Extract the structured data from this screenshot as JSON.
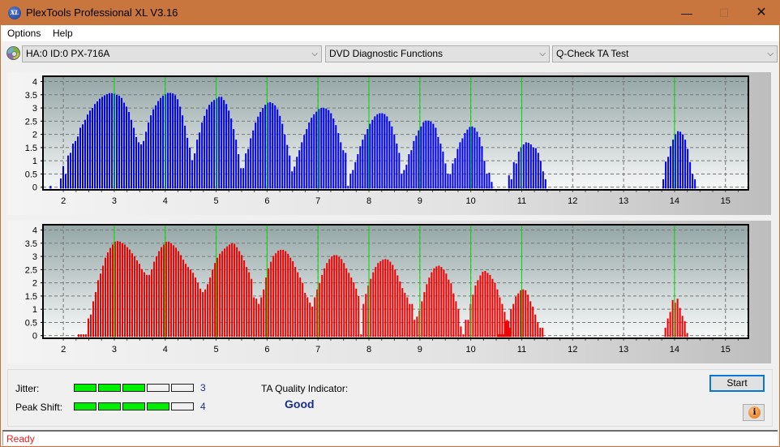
{
  "window": {
    "title": "PlexTools Professional XL V3.16",
    "icon_label": "XL",
    "controls": {
      "minimize": "—",
      "maximize": "☐",
      "close": "✕"
    }
  },
  "menu": {
    "items": [
      {
        "label": "Options"
      },
      {
        "label": "Help"
      }
    ]
  },
  "toolbar": {
    "drive_select": "HA:0 ID:0  PX-716A",
    "function_select": "DVD Diagnostic Functions",
    "test_select": "Q-Check TA Test",
    "chevron": "⌵"
  },
  "colors": {
    "title_bar": "#c8763e",
    "jitter_bars": "#0000ee",
    "peak_shift_bars": "#ee0000",
    "marker_lines": "#00dd00",
    "meter_on": "#00ee00",
    "value_text": "#1c2e8c",
    "status_text": "#ee1c1c"
  },
  "chart_data": [
    {
      "type": "bar",
      "name": "jitter-distribution",
      "title": "",
      "xlabel": "",
      "ylabel": "",
      "xlim": [
        1.6,
        15.45
      ],
      "ylim": [
        -0.1,
        4.2
      ],
      "x_ticks": [
        "2",
        "3",
        "4",
        "5",
        "6",
        "7",
        "8",
        "9",
        "10",
        "11",
        "12",
        "13",
        "14",
        "15"
      ],
      "y_ticks": [
        "0",
        "0.5",
        "1",
        "1.5",
        "2",
        "2.5",
        "3",
        "3.5",
        "4"
      ],
      "grid": true,
      "marker_lines_at": [
        3,
        4,
        5,
        6,
        7,
        8,
        9,
        10,
        11,
        14
      ],
      "series": [
        {
          "name": "Jitter",
          "color": "#0000ee",
          "clusters": [
            {
              "start": 1.75,
              "values": [
                0.05
              ]
            },
            {
              "start": 1.95,
              "values": [
                0.33,
                0.8,
                0.5,
                1.2,
                1.3,
                1.65,
                1.75,
                1.92,
                2.25,
                2.38,
                2.55,
                2.75,
                2.9,
                3.0,
                3.15,
                3.25,
                3.35,
                3.42,
                3.48,
                3.52,
                3.56,
                3.56,
                3.54,
                3.5,
                3.46,
                3.38,
                3.2,
                3.05,
                2.85,
                2.55,
                2.25,
                1.9,
                1.7,
                1.62,
                1.75,
                2.1,
                2.45,
                2.72,
                2.95,
                3.1,
                3.26,
                3.38,
                3.46,
                3.52,
                3.57,
                3.57,
                3.55,
                3.48,
                3.33,
                3.05,
                2.72,
                2.33,
                1.87,
                1.5,
                1.02,
                1.28,
                1.8,
                2.07,
                2.45,
                2.7,
                2.95,
                3.12,
                3.23,
                3.3,
                3.36,
                3.42,
                3.42,
                3.3,
                3.15,
                2.9,
                2.6,
                2.2,
                1.8,
                1.25,
                0.72,
                0.72,
                1.28,
                1.45,
                1.85,
                2.15,
                2.45,
                2.67,
                2.85,
                3.0,
                3.12,
                3.2,
                3.22,
                3.18,
                3.1,
                2.95,
                2.7,
                2.4,
                2.0,
                1.6,
                1.2,
                0.6,
                0.78,
                1.15,
                1.4,
                1.7,
                1.98,
                2.2,
                2.45,
                2.63,
                2.76,
                2.86,
                2.96,
                3.0,
                3.0,
                2.98,
                2.92,
                2.8,
                2.6,
                2.35,
                2.05,
                1.7,
                1.4,
                1.3,
                0.05,
                0.5,
                0.65,
                0.95,
                1.25,
                1.55,
                1.8,
                2.0,
                2.2,
                2.4,
                2.55,
                2.68,
                2.76,
                2.8,
                2.8,
                2.77,
                2.68,
                2.5,
                2.3,
                2.0,
                1.65,
                1.3,
                0.5,
                0.65,
                0.85,
                1.25,
                1.4,
                1.75,
                1.95,
                2.15,
                2.3,
                2.46,
                2.52,
                2.52,
                2.48,
                2.4,
                2.25,
                1.9,
                1.65,
                1.35,
                0.9,
                0.5,
                0.5,
                0.9,
                1.1,
                1.45,
                1.7,
                1.85,
                2.05,
                2.18,
                2.28,
                2.3,
                2.25,
                2.1,
                1.9,
                1.55,
                1.0,
                0.5,
                0.55,
                0.2
              ]
            },
            {
              "start": 10.75,
              "values": [
                0.45,
                0.3,
                0.95,
                0.9,
                1.35,
                1.5,
                1.62,
                1.7,
                1.68,
                1.62,
                1.5,
                1.48,
                1.3,
                1.0,
                0.6,
                0.3
              ]
            },
            {
              "start": 13.78,
              "values": [
                0.3,
                0.97,
                1.15,
                1.55,
                1.8,
                2.0,
                2.12,
                2.1,
                2.0,
                1.8,
                1.45,
                0.95,
                0.5,
                0.3
              ]
            }
          ]
        }
      ]
    },
    {
      "type": "bar",
      "name": "peak-shift-distribution",
      "title": "",
      "xlabel": "",
      "ylabel": "",
      "xlim": [
        1.6,
        15.45
      ],
      "ylim": [
        -0.1,
        4.2
      ],
      "x_ticks": [
        "2",
        "3",
        "4",
        "5",
        "6",
        "7",
        "8",
        "9",
        "10",
        "11",
        "12",
        "13",
        "14",
        "15"
      ],
      "y_ticks": [
        "0",
        "0.5",
        "1",
        "1.5",
        "2",
        "2.5",
        "3",
        "3.5",
        "4"
      ],
      "grid": true,
      "marker_lines_at": [
        3,
        4,
        5,
        6,
        7,
        8,
        9,
        10,
        11,
        14
      ],
      "series": [
        {
          "name": "Peak Shift",
          "color": "#ee0000",
          "clusters": [
            {
              "start": 2.3,
              "values": [
                0.05,
                0.05,
                0.05,
                0.05,
                0.65,
                0.8,
                1.3,
                1.65,
                2.1,
                2.35,
                2.65,
                2.95,
                3.15,
                3.32,
                3.45,
                3.56,
                3.58,
                3.56,
                3.5,
                3.45,
                3.35,
                3.26,
                3.12,
                3.0,
                2.85,
                2.72,
                2.52,
                2.4,
                2.3,
                2.3,
                2.5,
                2.8,
                3.0,
                3.2,
                3.35,
                3.45,
                3.55,
                3.56,
                3.5,
                3.42,
                3.33,
                3.2,
                3.05,
                2.88,
                2.72,
                2.6,
                2.5,
                2.38,
                2.2,
                2.0,
                1.78,
                1.65,
                1.75,
                1.95,
                2.2,
                2.5,
                2.75,
                2.95,
                3.1,
                3.2,
                3.3,
                3.38,
                3.45,
                3.5,
                3.48,
                3.35,
                3.2,
                3.05,
                2.85,
                2.6,
                2.4,
                2.15,
                1.45,
                1.4,
                1.2,
                1.45,
                1.75,
                2.2,
                2.55,
                2.8,
                3.02,
                3.12,
                3.22,
                3.25,
                3.25,
                3.2,
                3.1,
                2.95,
                2.82,
                2.6,
                2.4,
                2.2,
                2.0,
                1.62,
                1.45,
                1.25,
                1.1,
                1.45,
                1.75,
                2.0,
                2.3,
                2.55,
                2.75,
                2.9,
                3.0,
                3.05,
                3.05,
                2.98,
                2.9,
                2.75,
                2.55,
                2.38,
                2.2,
                2.02,
                1.78,
                1.5,
                0.05,
                1.2,
                1.58,
                1.9,
                2.15,
                2.4,
                2.6,
                2.75,
                2.82,
                2.88,
                2.9,
                2.88,
                2.8,
                2.68,
                2.5,
                2.28,
                2.05,
                1.8,
                1.62,
                1.45,
                1.2,
                1.2,
                0.6,
                0.72,
                0.95,
                1.3,
                1.65,
                1.95,
                2.2,
                2.4,
                2.55,
                2.62,
                2.65,
                2.6,
                2.5,
                2.35,
                2.12,
                1.98,
                1.6,
                1.3,
                1.0,
                0.35,
                0.05,
                0.6,
                0.6,
                1.2,
                1.55,
                1.9,
                2.1,
                2.28,
                2.42,
                2.45,
                2.38,
                2.3,
                2.15,
                2.0,
                1.75,
                1.45,
                1.2,
                0.9,
                0.6,
                0.3
              ]
            },
            {
              "start": 10.55,
              "values": [
                0.05,
                0.05,
                0.05,
                0.55,
                0.55,
                1.0,
                1.2,
                1.48,
                1.6,
                1.72,
                1.75,
                1.72,
                1.55,
                1.3,
                1.1,
                0.8,
                0.5,
                0.3,
                0.3
              ]
            },
            {
              "start": 13.82,
              "values": [
                0.3,
                0.65,
                0.9,
                1.35,
                1.25,
                1.4,
                1.05,
                0.75,
                0.55,
                0.1
              ]
            }
          ]
        }
      ]
    }
  ],
  "results": {
    "jitter_label": "Jitter:",
    "jitter_value": "3",
    "jitter_level": 3,
    "peak_shift_label": "Peak Shift:",
    "peak_shift_value": "4",
    "peak_shift_level": 4,
    "meter_segments": 5,
    "ta_quality_label": "TA Quality Indicator:",
    "ta_quality_value": "Good"
  },
  "buttons": {
    "start": "Start",
    "info": "i"
  },
  "status": {
    "text": "Ready"
  }
}
